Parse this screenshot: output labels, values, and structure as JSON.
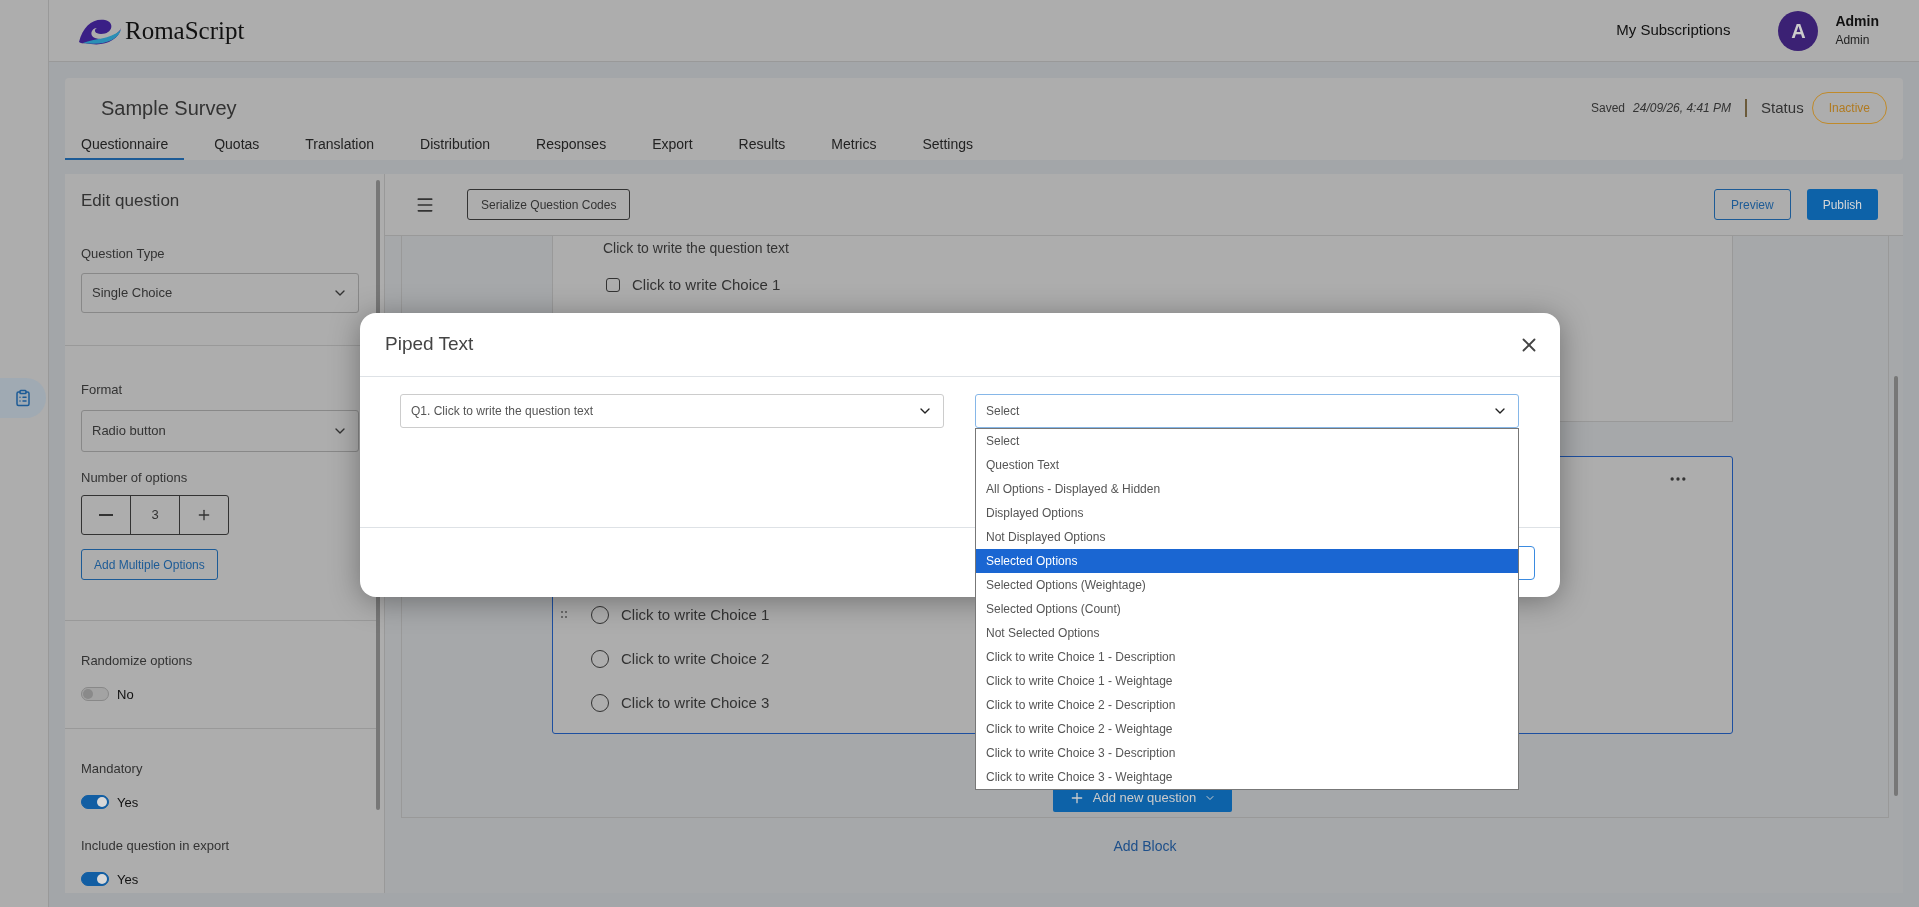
{
  "header": {
    "brand": "RomaScript",
    "link": "My Subscriptions",
    "user": {
      "initial": "A",
      "name": "Admin",
      "role": "Admin"
    }
  },
  "sidebar": {
    "items": [
      {
        "selected": true
      }
    ]
  },
  "survey": {
    "title": "Sample Survey",
    "saved_label": "Saved",
    "saved_time": "24/09/26, 4:41 PM",
    "status_label": "Status",
    "status": "Inactive"
  },
  "tabs": [
    {
      "label": "Questionnaire",
      "selected": true
    },
    {
      "label": "Quotas",
      "selected": false
    },
    {
      "label": "Translation",
      "selected": false
    },
    {
      "label": "Distribution",
      "selected": false
    },
    {
      "label": "Responses",
      "selected": false
    },
    {
      "label": "Export",
      "selected": false
    },
    {
      "label": "Results",
      "selected": false
    },
    {
      "label": "Metrics",
      "selected": false
    },
    {
      "label": "Settings",
      "selected": false
    }
  ],
  "edit_panel": {
    "title": "Edit question",
    "question_type": {
      "label": "Question Type",
      "value": "Single Choice"
    },
    "format": {
      "label": "Format",
      "value": "Radio button"
    },
    "number_of_options": {
      "label": "Number of options",
      "value": "3"
    },
    "add_multiple_button": "Add Multiple Options",
    "toggles": [
      {
        "label": "Randomize options",
        "on": false,
        "text": "No"
      },
      {
        "label": "Mandatory",
        "on": true,
        "text": "Yes"
      },
      {
        "label": "Include question in export",
        "on": true,
        "text": "Yes"
      }
    ]
  },
  "toolbar": {
    "serialize_button": "Serialize Question Codes",
    "preview_button": "Preview",
    "publish_button": "Publish"
  },
  "questions": [
    {
      "kind": "checkbox",
      "text": "Click to write the question text",
      "choices": [
        {
          "text": "Click to write Choice 1",
          "checked": false
        }
      ]
    },
    {
      "kind": "radio",
      "choices": [
        {
          "text": "Click to write Choice 1",
          "checked": false
        },
        {
          "text": "Click to write Choice 2",
          "checked": false
        },
        {
          "text": "Click to write Choice 3",
          "checked": false
        }
      ]
    }
  ],
  "add_question_button": "Add new question",
  "add_block": "Add Block",
  "modal": {
    "title": "Piped Text",
    "question_select": "Q1. Click to write the question text",
    "field_select": "Select",
    "options": [
      {
        "label": "Select",
        "selected": false
      },
      {
        "label": "Question Text",
        "selected": false
      },
      {
        "label": "All Options - Displayed & Hidden",
        "selected": false
      },
      {
        "label": "Displayed Options",
        "selected": false
      },
      {
        "label": "Not Displayed Options",
        "selected": false
      },
      {
        "label": "Selected Options",
        "selected": true
      },
      {
        "label": "Selected Options (Weightage)",
        "selected": false
      },
      {
        "label": "Selected Options (Count)",
        "selected": false
      },
      {
        "label": "Not Selected Options",
        "selected": false
      },
      {
        "label": "Click to write Choice 1 - Description",
        "selected": false
      },
      {
        "label": "Click to write Choice 1 - Weightage",
        "selected": false
      },
      {
        "label": "Click to write Choice 2 - Description",
        "selected": false
      },
      {
        "label": "Click to write Choice 2 - Weightage",
        "selected": false
      },
      {
        "label": "Click to write Choice 3 - Description",
        "selected": false
      },
      {
        "label": "Click to write Choice 3 - Weightage",
        "selected": false
      }
    ]
  }
}
